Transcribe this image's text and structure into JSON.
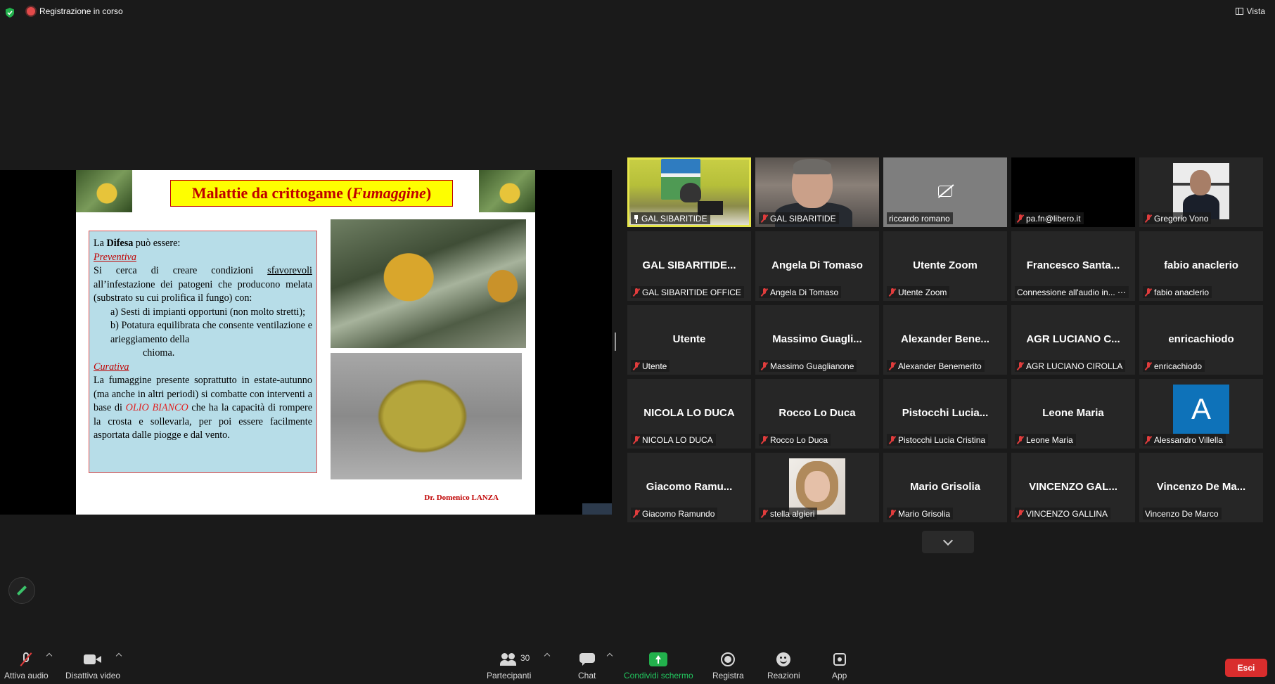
{
  "top_bar": {
    "recording_label": "Registrazione in corso",
    "view_label": "Vista"
  },
  "slide": {
    "title_main": "Malattie da crittogame (",
    "title_italic": "Fumaggine",
    "title_close": ")",
    "intro_a": "La ",
    "intro_bold": "Difesa",
    "intro_b": " può essere:",
    "preventiva": "Preventiva",
    "prev_line1a": "Si cerca di creare condizioni ",
    "prev_line1u": "sfavorevoli",
    "prev_body": "all’infestazione dei patogeni che producono melata (substrato su cui prolifica il fungo) con:",
    "item_a": "a) Sesti di impianti opportuni (non molto stretti);",
    "item_b": "b) Potatura equilibrata che consente ventilazione e arieggiamento della",
    "item_b2": "chioma.",
    "curativa": "Curativa",
    "cur_body_a": "La fumaggine presente soprattutto in estate-autunno (ma anche in altri periodi) si combatte con interventi a base di ",
    "cur_highlight": "OLIO BIANCO",
    "cur_body_b": " che ha la capacità di rompere la crosta e sollevarla, per poi essere facilmente asportata dalle piogge e dal vento.",
    "author": "Dr. Domenico LANZA"
  },
  "gallery": {
    "tiles": [
      {
        "center": "",
        "tag": "GAL SIBARITIDE",
        "muted": false,
        "pinned": true
      },
      {
        "center": "",
        "tag": "GAL SIBARITIDE",
        "muted": true,
        "pinned": false
      },
      {
        "center": "",
        "tag": "riccardo romano",
        "muted": false,
        "pinned": false
      },
      {
        "center": "",
        "tag": "pa.fn@libero.it",
        "muted": true,
        "pinned": false
      },
      {
        "center": "",
        "tag": "Gregorio Vono",
        "muted": true,
        "pinned": false
      },
      {
        "center": "GAL SIBARITIDE...",
        "tag": "GAL SIBARITIDE OFFICE",
        "muted": true,
        "pinned": false
      },
      {
        "center": "Angela Di Tomaso",
        "tag": "Angela Di Tomaso",
        "muted": true,
        "pinned": false
      },
      {
        "center": "Utente Zoom",
        "tag": "Utente Zoom",
        "muted": true,
        "pinned": false
      },
      {
        "center": "Francesco  Santa...",
        "tag": "Connessione all'audio in... ⋯",
        "muted": false,
        "pinned": false
      },
      {
        "center": "fabio anaclerio",
        "tag": "fabio anaclerio",
        "muted": true,
        "pinned": false
      },
      {
        "center": "Utente",
        "tag": "Utente",
        "muted": true,
        "pinned": false
      },
      {
        "center": "Massimo  Guagli...",
        "tag": "Massimo Guaglianone",
        "muted": true,
        "pinned": false
      },
      {
        "center": "Alexander  Bene...",
        "tag": "Alexander Benemerito",
        "muted": true,
        "pinned": false
      },
      {
        "center": "AGR LUCIANO C...",
        "tag": "AGR LUCIANO CIROLLA",
        "muted": true,
        "pinned": false
      },
      {
        "center": "enricachiodo",
        "tag": "enricachiodo",
        "muted": true,
        "pinned": false
      },
      {
        "center": "NICOLA LO DUCA",
        "tag": "NICOLA LO DUCA",
        "muted": true,
        "pinned": false
      },
      {
        "center": "Rocco Lo Duca",
        "tag": "Rocco Lo Duca",
        "muted": true,
        "pinned": false
      },
      {
        "center": "Pistocchi  Lucia...",
        "tag": "Pistocchi Lucia Cristina",
        "muted": true,
        "pinned": false
      },
      {
        "center": "Leone Maria",
        "tag": "Leone Maria",
        "muted": true,
        "pinned": false
      },
      {
        "center": "",
        "tag": "Alessandro Villella",
        "muted": true,
        "pinned": false,
        "avatar_letter": "A"
      },
      {
        "center": "Giacomo  Ramu...",
        "tag": "Giacomo Ramundo",
        "muted": true,
        "pinned": false
      },
      {
        "center": "",
        "tag": "stella algieri",
        "muted": true,
        "pinned": false
      },
      {
        "center": "Mario Grisolia",
        "tag": "Mario Grisolia",
        "muted": true,
        "pinned": false
      },
      {
        "center": "VINCENZO GAL...",
        "tag": "VINCENZO GALLINA",
        "muted": true,
        "pinned": false
      },
      {
        "center": "Vincenzo  De  Ma...",
        "tag": "Vincenzo De Marco",
        "muted": false,
        "pinned": false
      }
    ]
  },
  "toolbar": {
    "audio_label": "Attiva audio",
    "video_label": "Disattiva video",
    "participants_label": "Partecipanti",
    "participants_count": "30",
    "chat_label": "Chat",
    "share_label": "Condividi schermo",
    "record_label": "Registra",
    "reactions_label": "Reazioni",
    "apps_label": "App",
    "exit_label": "Esci"
  },
  "colors": {
    "share_green": "#22b14c",
    "exit_red": "#d92d2d",
    "active_speaker": "#e6e64a",
    "muted_red": "#e03c3c"
  }
}
